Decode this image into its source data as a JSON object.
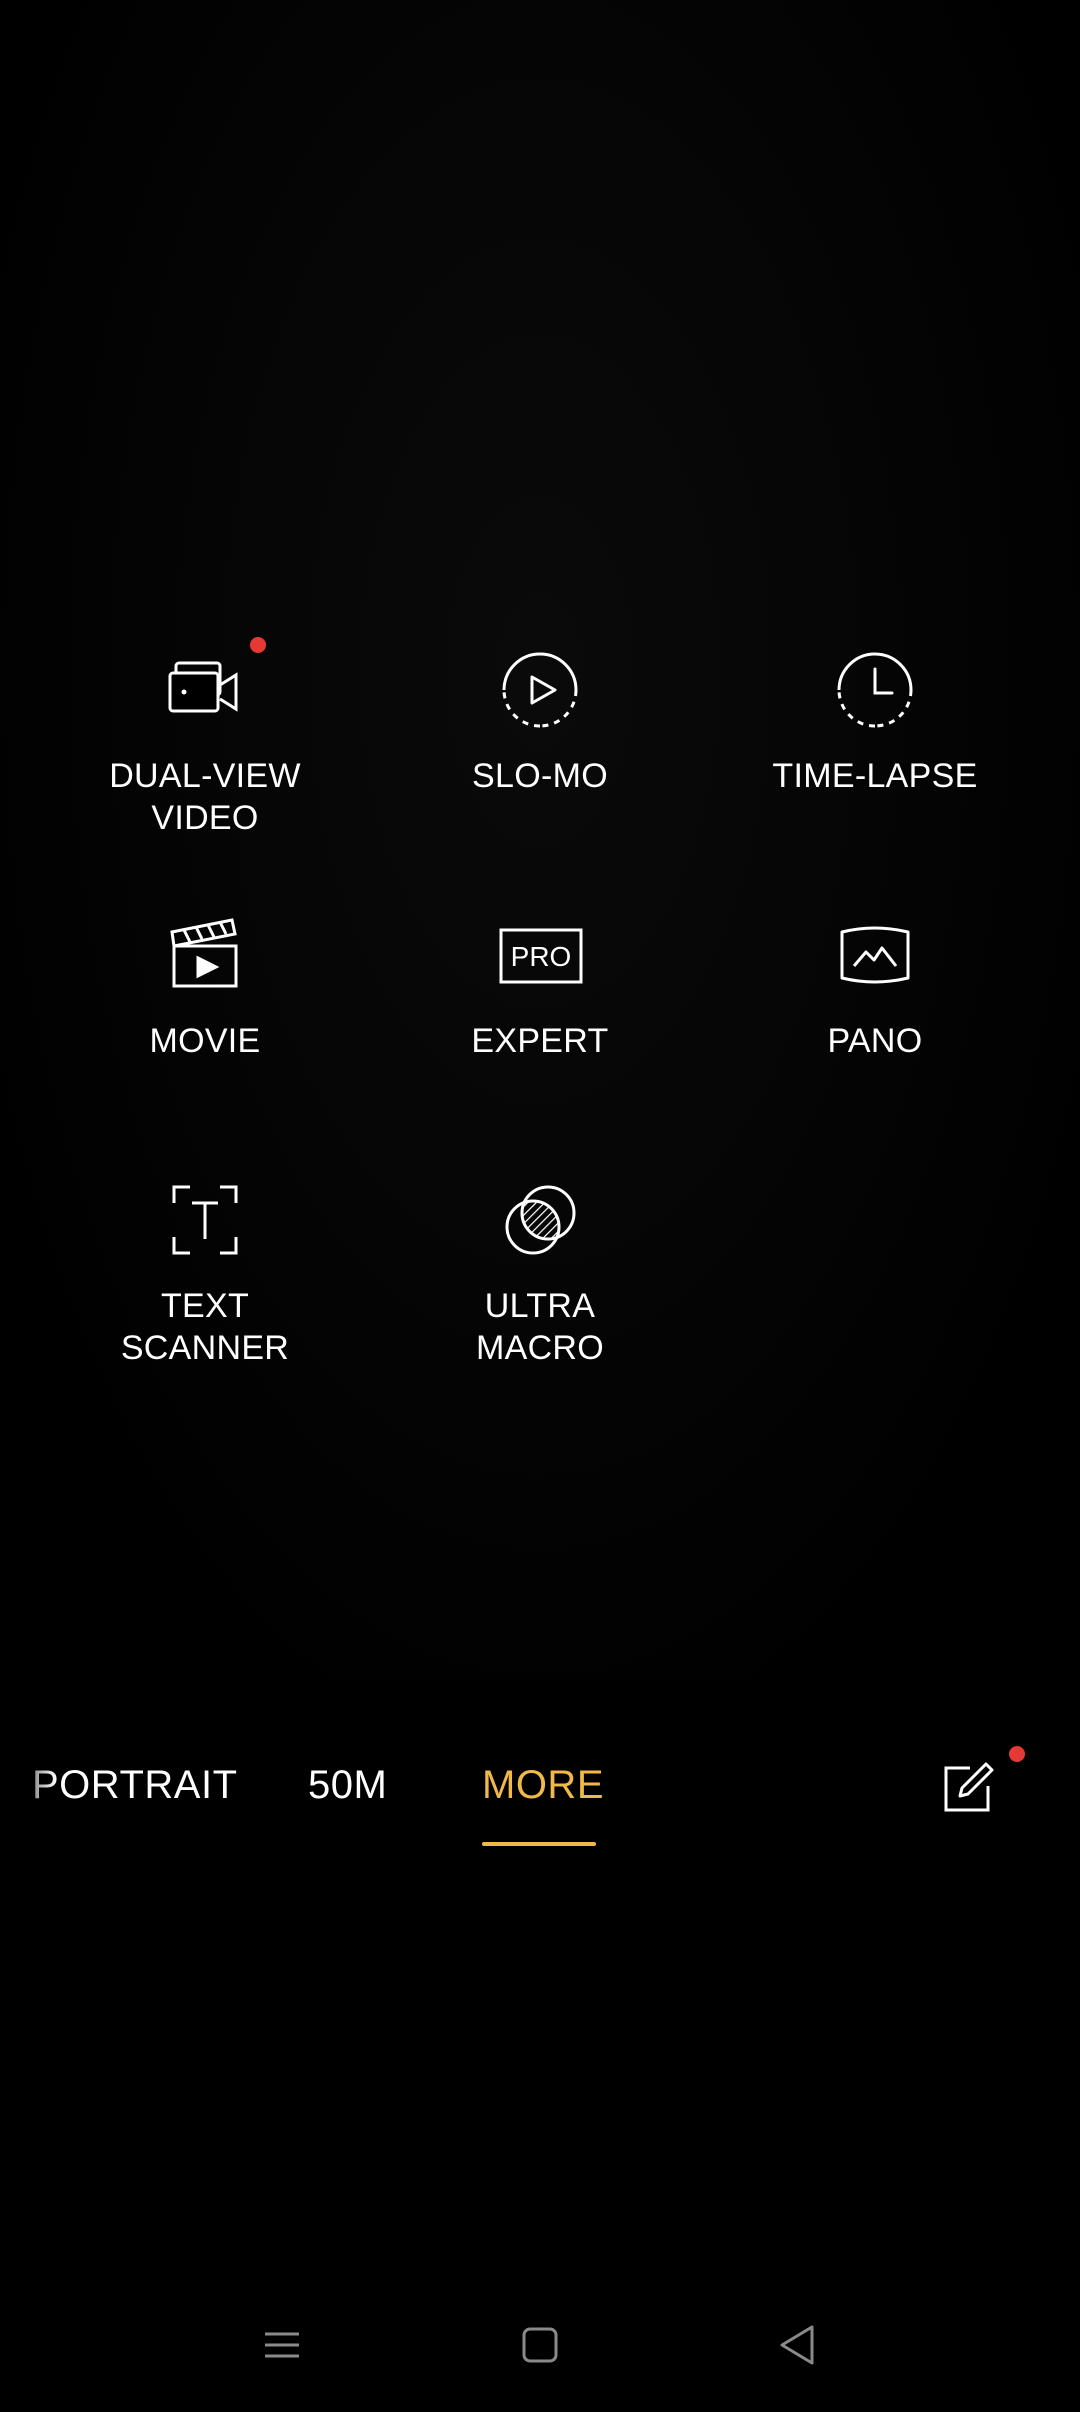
{
  "colors": {
    "accent": "#F1B94A",
    "dot": "#E53935",
    "text": "#FFFFFF",
    "nav": "#8A8A8A"
  },
  "modes": [
    {
      "label": "DUAL-VIEW\nVIDEO",
      "icon": "dual-view-video-icon",
      "new": true
    },
    {
      "label": "SLO-MO",
      "icon": "slo-mo-icon",
      "new": false
    },
    {
      "label": "TIME-LAPSE",
      "icon": "time-lapse-icon",
      "new": false
    },
    {
      "label": "MOVIE",
      "icon": "movie-clapperboard-icon",
      "new": false
    },
    {
      "label": "EXPERT",
      "icon": "pro-icon",
      "new": false
    },
    {
      "label": "PANO",
      "icon": "panorama-icon",
      "new": false
    },
    {
      "label": "TEXT\nSCANNER",
      "icon": "text-scanner-icon",
      "new": false
    },
    {
      "label": "ULTRA\nMACRO",
      "icon": "ultra-macro-icon",
      "new": false
    }
  ],
  "pro_icon_text": "PRO",
  "mode_strip": {
    "tabs": [
      "PORTRAIT",
      "50M",
      "MORE"
    ],
    "active": "MORE"
  },
  "edit_button": {
    "icon": "edit-icon",
    "new": true
  },
  "navbar": {
    "icons": [
      "menu-icon",
      "home-icon",
      "back-icon"
    ]
  }
}
